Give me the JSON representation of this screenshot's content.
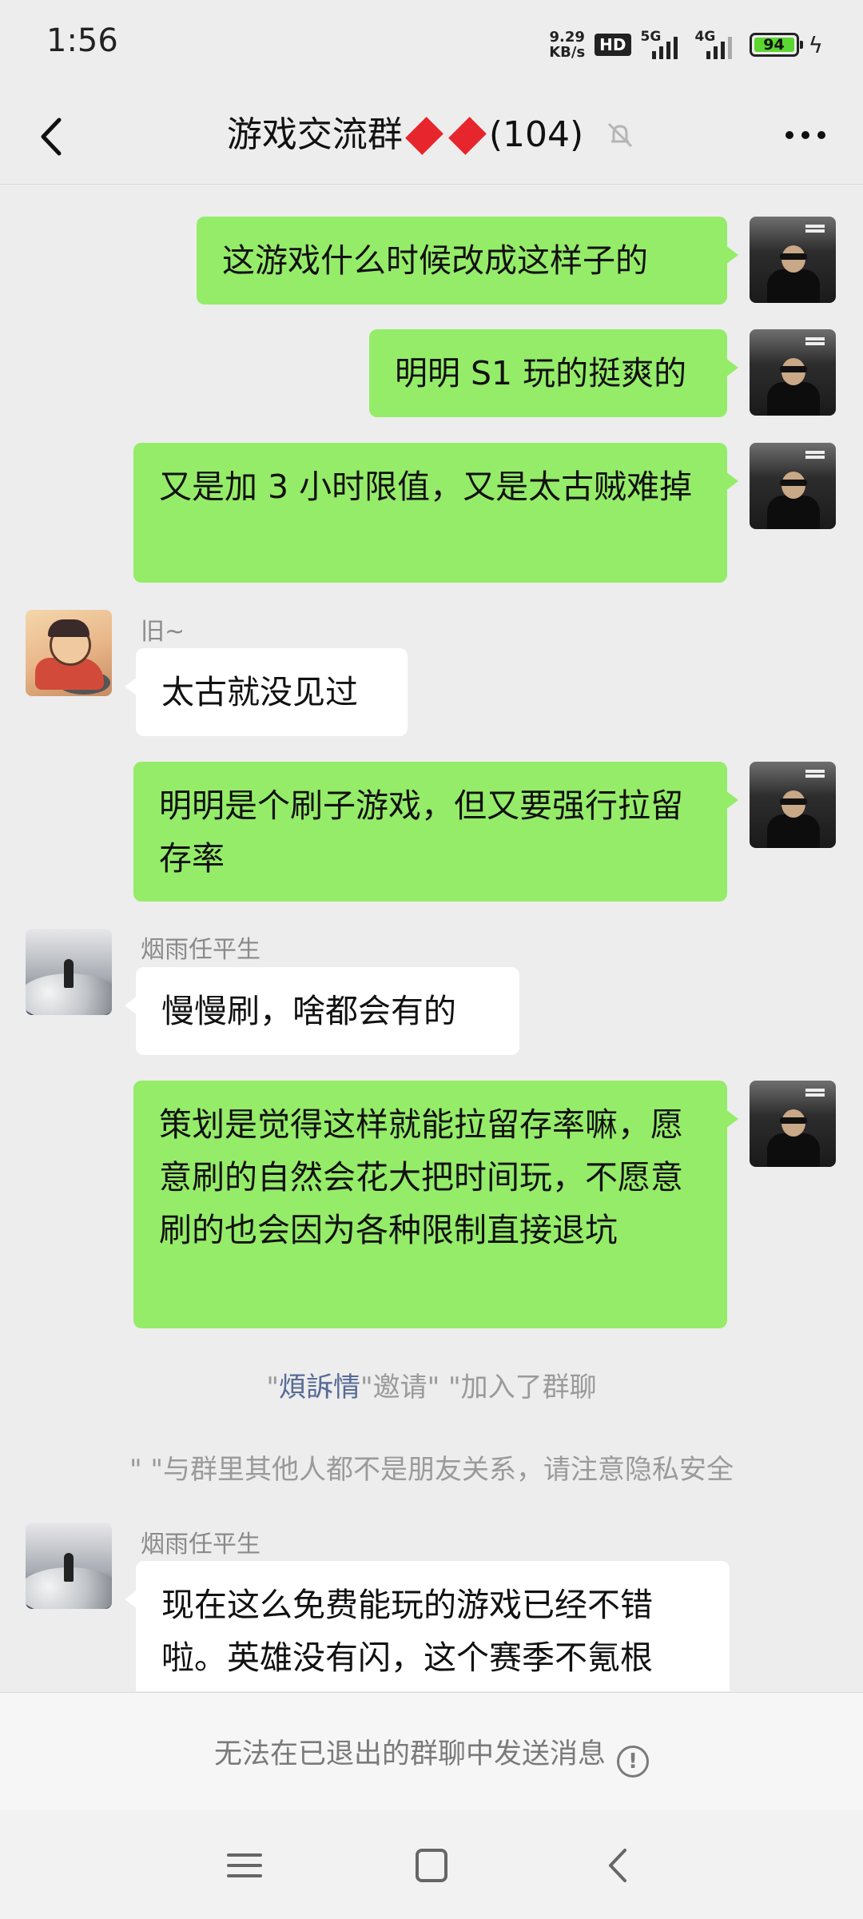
{
  "status_bar": {
    "time": "1:56",
    "speed_top": "9.29",
    "speed_bottom": "KB/s",
    "hd": "HD",
    "net1": "5G",
    "net2": "4G",
    "battery": "94"
  },
  "header": {
    "title_prefix": "游戏交流群",
    "title_count": "(104)",
    "icons": [
      "back-arrow-icon",
      "red-diamond-icon",
      "mute-bell-icon",
      "more-dots-icon"
    ]
  },
  "messages": [
    {
      "from": "me",
      "text": "这游戏什么时候改成这样子的"
    },
    {
      "from": "me",
      "text": "明明 S1 玩的挺爽的"
    },
    {
      "from": "me",
      "text": "又是加 3 小时限值，又是太古贼难掉"
    },
    {
      "from": "旧~",
      "text": "太古就没见过"
    },
    {
      "from": "me",
      "text": "明明是个刷子游戏，但又要强行拉留存率"
    },
    {
      "from": "烟雨任平生",
      "text": "慢慢刷，啥都会有的"
    },
    {
      "from": "me",
      "text": "策划是觉得这样就能拉留存率嘛，愿意刷的自然会花大把时间玩，不愿意刷的也会因为各种限制直接退坑"
    },
    {
      "from": "烟雨任平生",
      "text": "现在这么免费能玩的游戏已经不错啦。英雄没有闪，这个赛季不氪根"
    }
  ],
  "nicknames": {
    "jiu": "旧~",
    "yanyu": "烟雨任平生"
  },
  "system": {
    "invite_q1": "\"",
    "invite_name": "煩訴情",
    "invite_rest": "\"邀请\" \"加入了群聊",
    "privacy": "\" \"与群里其他人都不是朋友关系，请注意隐私安全"
  },
  "bottom_bar": {
    "text": "无法在已退出的群聊中发送消息"
  },
  "colors": {
    "my_bubble": "#95ec69",
    "link": "#576b95",
    "diamond": "#e6262c",
    "background": "#ededed"
  }
}
